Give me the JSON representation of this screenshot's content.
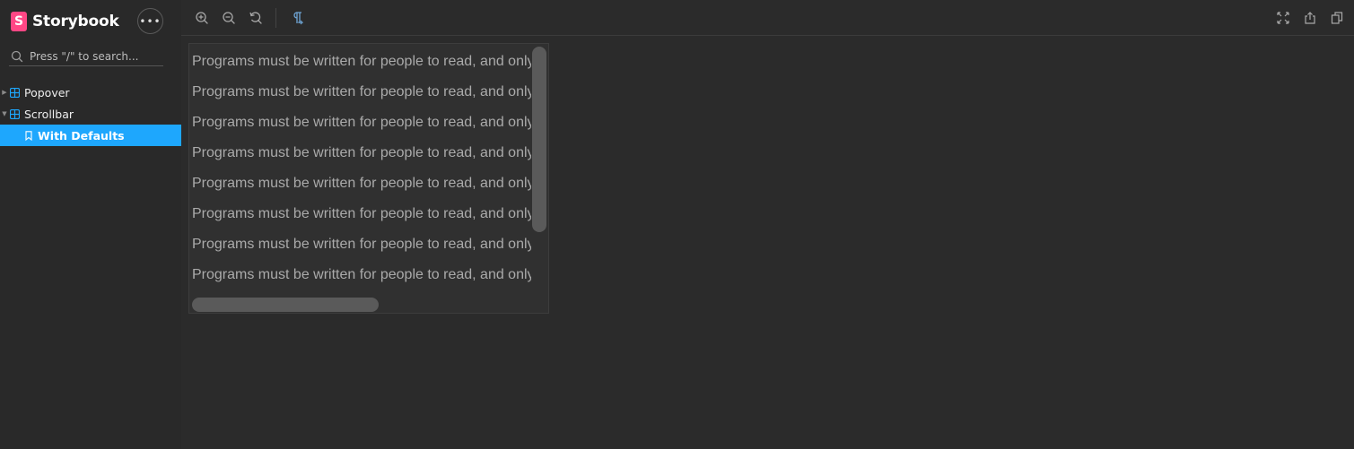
{
  "app": {
    "name": "Storybook",
    "logo_letter": "S",
    "accent": "#ff4785",
    "selection": "#1ea7fd"
  },
  "sidebar": {
    "menu_label": "•••",
    "search": {
      "placeholder": "Press \"/\" to search..."
    },
    "items": [
      {
        "label": "Popover",
        "expanded": false,
        "icon": "component-icon"
      },
      {
        "label": "Scrollbar",
        "expanded": true,
        "icon": "component-icon"
      },
      {
        "label": "With Defaults",
        "selected": true,
        "icon": "bookmark-icon"
      }
    ]
  },
  "toolbar": {
    "left_icons": [
      "zoom-in-icon",
      "zoom-out-icon",
      "zoom-reset-icon",
      "paragraph-icon"
    ],
    "right_icons": [
      "fullscreen-icon",
      "share-icon",
      "copy-icon"
    ]
  },
  "story": {
    "lines": [
      "Programs must be written for people to read, and only",
      "Programs must be written for people to read, and only",
      "Programs must be written for people to read, and only",
      "Programs must be written for people to read, and only",
      "Programs must be written for people to read, and only",
      "Programs must be written for people to read, and only",
      "Programs must be written for people to read, and only",
      "Programs must be written for people to read, and only"
    ]
  }
}
